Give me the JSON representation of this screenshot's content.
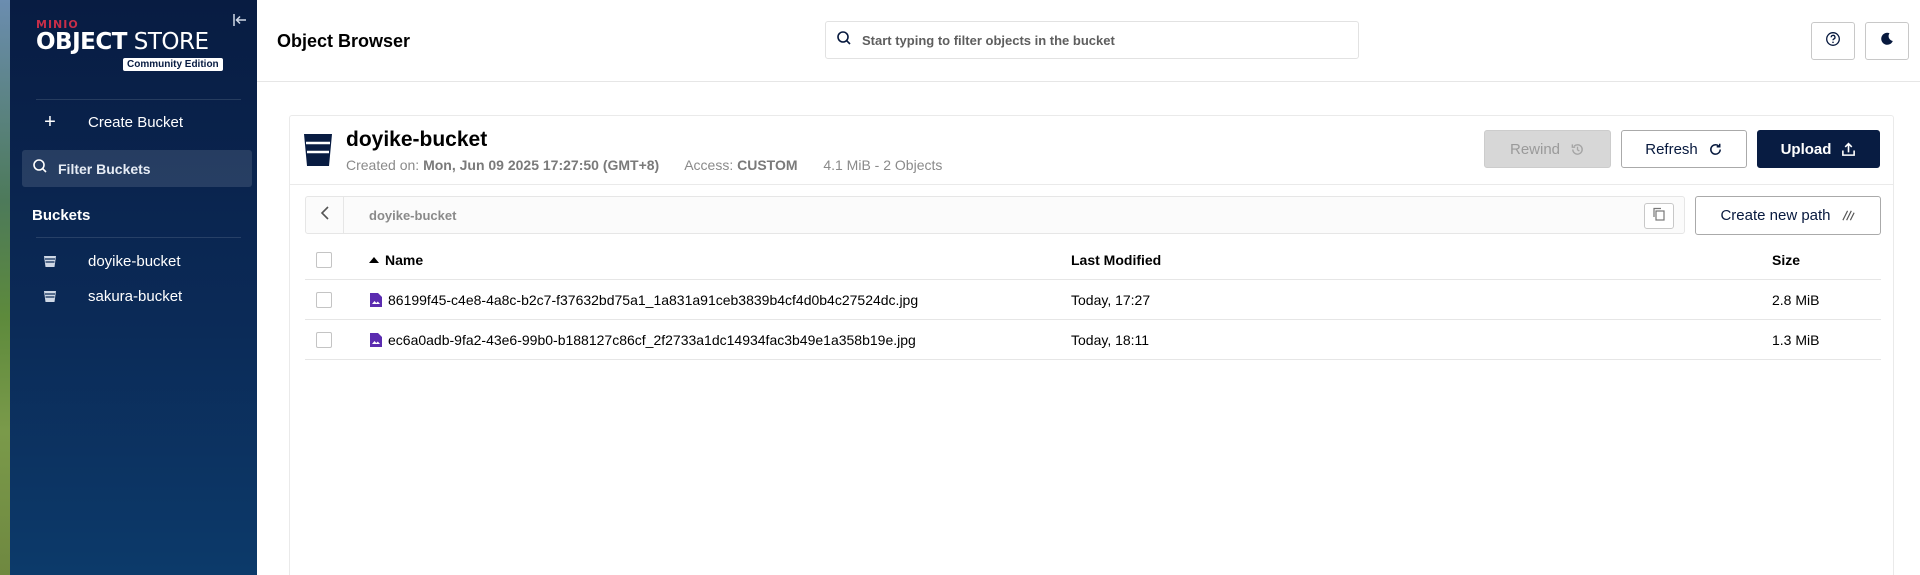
{
  "sidebar": {
    "logo": {
      "brand": "MINIO",
      "product_bold": "OBJECT",
      "product_light": " STORE",
      "edition": "Community Edition"
    },
    "create_bucket_label": "Create Bucket",
    "filter_placeholder": "Filter Buckets",
    "buckets_title": "Buckets",
    "buckets": [
      {
        "label": "doyike-bucket"
      },
      {
        "label": "sakura-bucket"
      }
    ]
  },
  "header": {
    "title": "Object Browser",
    "search_placeholder": "Start typing to filter objects in the bucket"
  },
  "bucket": {
    "name": "doyike-bucket",
    "created_label": "Created on:",
    "created_value": "Mon, Jun 09 2025 17:27:50 (GMT+8)",
    "access_label": "Access:",
    "access_value": "CUSTOM",
    "summary": "4.1 MiB - 2 Objects"
  },
  "actions": {
    "rewind_label": "Rewind",
    "refresh_label": "Refresh",
    "upload_label": "Upload",
    "create_path_label": "Create new path"
  },
  "path": {
    "current": "doyike-bucket"
  },
  "table": {
    "columns": {
      "name": "Name",
      "modified": "Last Modified",
      "size": "Size"
    },
    "rows": [
      {
        "name": "86199f45-c4e8-4a8c-b2c7-f37632bd75a1_1a831a91ceb3839b4cf4d0b4c27524dc.jpg",
        "modified": "Today, 17:27",
        "size": "2.8 MiB"
      },
      {
        "name": "ec6a0adb-9fa2-43e6-99b0-b188127c86cf_2f2733a1dc14934fac3b49e1a358b19e.jpg",
        "modified": "Today, 18:11",
        "size": "1.3 MiB"
      }
    ]
  },
  "colors": {
    "brand_dark": "#081c42",
    "brand_red": "#c72e49",
    "file_icon": "#5b2cb0"
  }
}
